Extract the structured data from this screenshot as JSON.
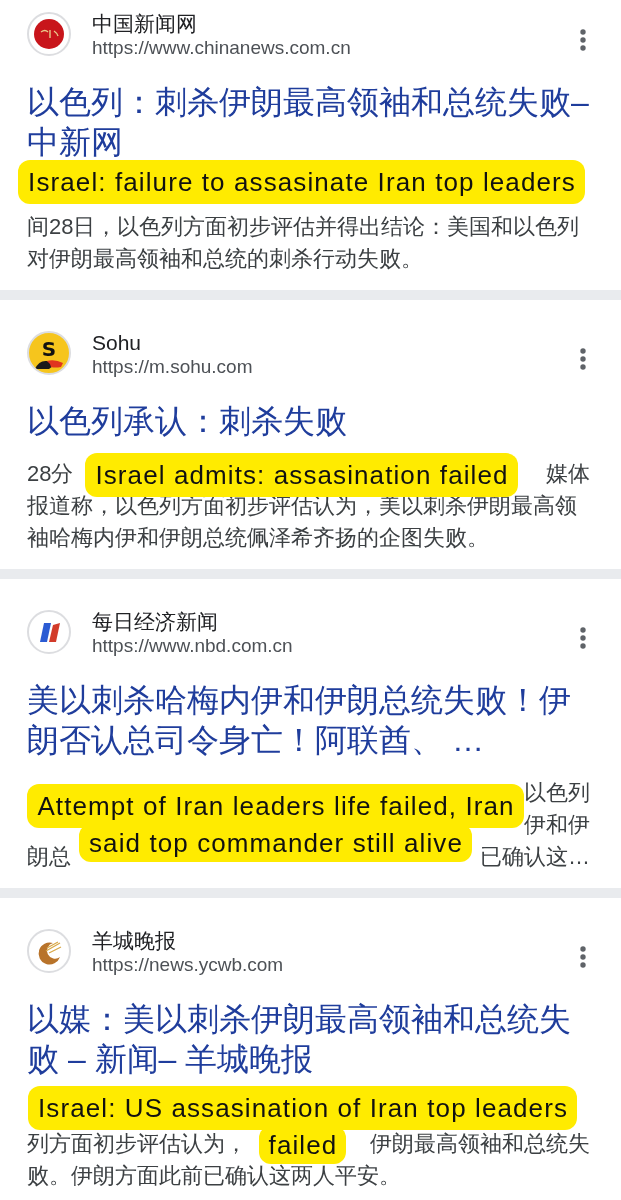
{
  "results": [
    {
      "site_name": "中国新闻网",
      "url": "https://www.chinanews.com.cn",
      "logo": {
        "kind": "seal"
      },
      "title": "以色列：刺杀伊朗最高领袖和总统失败–中新网",
      "snippet_lines": [
        {
          "start": "间28日，以色列方面初步评估并得出结论：美国和以色列"
        },
        {
          "start": "对伊朗最高领袖和总统的刺杀行动失败。"
        }
      ],
      "caption": [
        "Israel: failure to assasinate Iran top leaders"
      ]
    },
    {
      "site_name": "Sohu",
      "url": "https://m.sohu.com",
      "logo": {
        "kind": "letter",
        "text": "S"
      },
      "title": "以色列承认：刺杀失败",
      "snippet_lines": [
        {
          "start": "28分",
          "end": "媒体"
        },
        {
          "start": "报道称，以色列方面初步评估认为，美以刺杀伊朗最高领"
        },
        {
          "start": "袖哈梅内伊和伊朗总统佩泽希齐扬的企图失败。"
        }
      ],
      "caption": [
        "Israel admits: assasination failed"
      ]
    },
    {
      "site_name": "每日经济新闻",
      "url": "https://www.nbd.com.cn",
      "logo": {
        "kind": "stripes"
      },
      "title": "美以刺杀哈梅内伊和伊朗总统失败！伊朗否认总司令身亡！阿联酋、 …",
      "snippet_lines": [
        {
          "end": "以色列"
        },
        {
          "end": "伊和伊"
        },
        {
          "start": "朗总",
          "end": "已确认这…"
        }
      ],
      "caption": [
        "Attempt of Iran leaders life failed, Iran",
        "said top commander still alive"
      ]
    },
    {
      "site_name": "羊城晚报",
      "url": "https://news.ycwb.com",
      "logo": {
        "kind": "crescent"
      },
      "title": "以媒：美以刺杀伊朗最高领袖和总统失败 – 新闻– 羊城晚报",
      "snippet_lines": [
        {
          "start": "列方面初步评估认为，",
          "end": "伊朗最高领袖和总统失"
        },
        {
          "start": "败。伊朗方面此前已确认这两人平安。"
        }
      ],
      "caption": [
        "Israel: US assasination of Iran top leaders",
        "failed"
      ]
    }
  ]
}
